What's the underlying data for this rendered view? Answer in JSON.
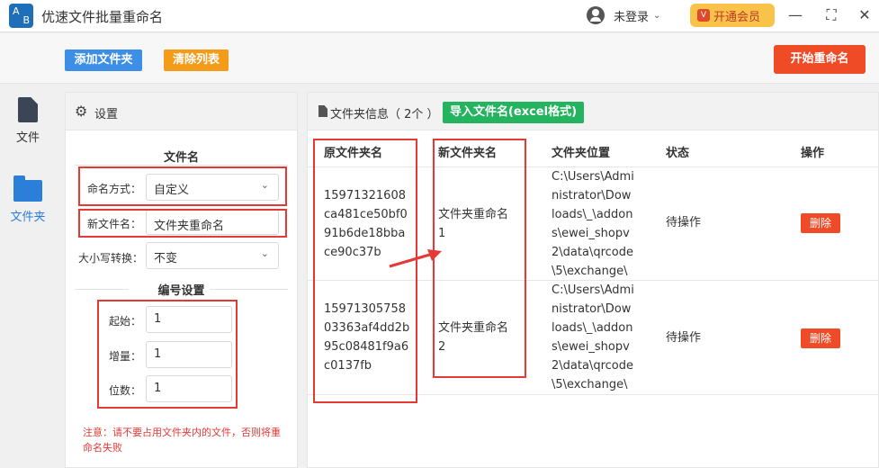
{
  "app": {
    "title": "优速文件批量重命名",
    "logo_a": "A",
    "logo_b": "B",
    "user_label": "未登录",
    "vip_label": "开通会员",
    "vip_icon": "V"
  },
  "toolbar": {
    "add_folder": "添加文件夹",
    "clear_list": "清除列表",
    "start_rename": "开始重命名"
  },
  "nav": {
    "file_label": "文件",
    "folder_label": "文件夹"
  },
  "settings": {
    "title": "设置",
    "filename_section": "文件名",
    "naming_mode_label": "命名方式：",
    "naming_mode_value": "自定义",
    "new_name_label": "新文件名：",
    "new_name_value": "文件夹重命名",
    "case_label": "大小写转换：",
    "case_value": "不变",
    "number_section": "编号设置",
    "start_label": "起始：",
    "start_value": "1",
    "step_label": "增量：",
    "step_value": "1",
    "digits_label": "位数：",
    "digits_value": "1",
    "note": "注意：请不要占用文件夹内的文件，否则将重命名失败"
  },
  "folder_info": {
    "title": "文件夹信息（ 2个 ）",
    "import_button": "导入文件名(excel格式)",
    "columns": [
      "原文件夹名",
      "新文件夹名",
      "文件夹位置",
      "状态",
      "操作"
    ],
    "rows": [
      {
        "original": "15971321608\nca481ce50bf0\n91b6de18bba\nce90c37b",
        "new_name": "文件夹重命名\n1",
        "location": "C:\\Users\\Admi\nnistrator\\Dow\nloads\\_\\addon\ns\\ewei_shopv\n2\\data\\qrcode\n\\5\\exchange\\",
        "status": "待操作",
        "action": "删除"
      },
      {
        "original": "15971305758\n03363af4dd2b\n95c08481f9a6\nc0137fb",
        "new_name": "文件夹重命名\n2",
        "location": "C:\\Users\\Admi\nnistrator\\Dow\nloads\\_\\addon\ns\\ewei_shopv\n2\\data\\qrcode\n\\5\\exchange\\",
        "status": "待操作",
        "action": "删除"
      }
    ]
  },
  "colors": {
    "primary_blue": "#3d8ee6",
    "orange": "#f59b1a",
    "red": "#ef4b27",
    "green": "#24b35f",
    "annotation_red": "#e53935"
  }
}
